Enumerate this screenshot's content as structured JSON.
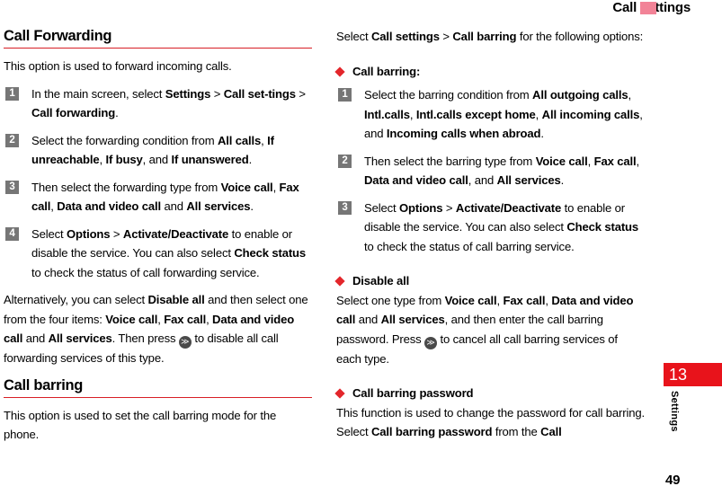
{
  "header": {
    "title": "Call settings",
    "mark_color": "#F28397"
  },
  "chapter_tab": {
    "number": "13",
    "label": "Settings",
    "color": "#E8131B"
  },
  "page_number": "49",
  "theme": {
    "rule_color": "#D81F26",
    "diamond_color": "#E3262B",
    "step_badge_color": "#767676",
    "key_icon_color": "#4A4A4A"
  },
  "icons": {
    "key": "≫",
    "key_name": "end-key-icon"
  },
  "left_column": {
    "heading_1": "Call Forwarding",
    "intro": "This option is used to forward incoming calls.",
    "steps": [
      {
        "num": "1",
        "parts": [
          {
            "t": "In the main screen, select ",
            "b": false
          },
          {
            "t": "Settings",
            "b": true
          },
          {
            "t": " > ",
            "b": false
          },
          {
            "t": "Call set-tings",
            "b": true
          },
          {
            "t": " > ",
            "b": false
          },
          {
            "t": "Call forwarding",
            "b": true
          },
          {
            "t": ".",
            "b": false
          }
        ]
      },
      {
        "num": "2",
        "parts": [
          {
            "t": "Select the forwarding condition from ",
            "b": false
          },
          {
            "t": "All calls",
            "b": true
          },
          {
            "t": ", ",
            "b": false
          },
          {
            "t": "If unreachable",
            "b": true
          },
          {
            "t": ", ",
            "b": false
          },
          {
            "t": "If busy",
            "b": true
          },
          {
            "t": ", and ",
            "b": false
          },
          {
            "t": "If unanswered",
            "b": true
          },
          {
            "t": ".",
            "b": false
          }
        ]
      },
      {
        "num": "3",
        "parts": [
          {
            "t": "Then select the forwarding type from ",
            "b": false
          },
          {
            "t": "Voice call",
            "b": true
          },
          {
            "t": ", ",
            "b": false
          },
          {
            "t": "Fax call",
            "b": true
          },
          {
            "t": ", ",
            "b": false
          },
          {
            "t": "Data and video call",
            "b": true
          },
          {
            "t": " and ",
            "b": false
          },
          {
            "t": "All services",
            "b": true
          },
          {
            "t": ".",
            "b": false
          }
        ]
      },
      {
        "num": "4",
        "parts": [
          {
            "t": "Select ",
            "b": false
          },
          {
            "t": "Options",
            "b": true
          },
          {
            "t": " > ",
            "b": false
          },
          {
            "t": "Activate/Deactivate",
            "b": true
          },
          {
            "t": " to enable or disable the service. You can also select ",
            "b": false
          },
          {
            "t": "Check status",
            "b": true
          },
          {
            "t": " to check the status of call forwarding service.",
            "b": false
          }
        ]
      }
    ],
    "alternatively": {
      "parts": [
        {
          "t": "Alternatively, you can select ",
          "b": false
        },
        {
          "t": "Disable all",
          "b": true
        },
        {
          "t": " and then select one from the four items: ",
          "b": false
        },
        {
          "t": "Voice call",
          "b": true
        },
        {
          "t": ", ",
          "b": false
        },
        {
          "t": "Fax call",
          "b": true
        },
        {
          "t": ", ",
          "b": false
        },
        {
          "t": "Data and video call",
          "b": true
        },
        {
          "t": " and ",
          "b": false
        },
        {
          "t": "All services",
          "b": true
        },
        {
          "t": ". Then press ",
          "b": false
        },
        {
          "t": "[KEY]",
          "b": false
        },
        {
          "t": " to disable all call forwarding services of this type.",
          "b": false
        }
      ]
    },
    "heading_2": "Call barring",
    "barring_intro": "This option is used to set the call barring mode for the phone."
  },
  "right_column": {
    "intro": {
      "parts": [
        {
          "t": "Select ",
          "b": false
        },
        {
          "t": "Call settings",
          "b": true
        },
        {
          "t": " > ",
          "b": false
        },
        {
          "t": "Call barring",
          "b": true
        },
        {
          "t": " for the following options:",
          "b": false
        }
      ]
    },
    "section_1_title": "Call barring:",
    "steps": [
      {
        "num": "1",
        "parts": [
          {
            "t": "Select the barring condition from ",
            "b": false
          },
          {
            "t": "All outgoing calls",
            "b": true
          },
          {
            "t": ", ",
            "b": false
          },
          {
            "t": "Intl.calls",
            "b": true
          },
          {
            "t": ", ",
            "b": false
          },
          {
            "t": "Intl.calls except home",
            "b": true
          },
          {
            "t": ", ",
            "b": false
          },
          {
            "t": "All incoming calls",
            "b": true
          },
          {
            "t": ", and ",
            "b": false
          },
          {
            "t": "Incoming calls when abroad",
            "b": true
          },
          {
            "t": ".",
            "b": false
          }
        ]
      },
      {
        "num": "2",
        "parts": [
          {
            "t": "Then select the barring type from ",
            "b": false
          },
          {
            "t": "Voice call",
            "b": true
          },
          {
            "t": ", ",
            "b": false
          },
          {
            "t": "Fax call",
            "b": true
          },
          {
            "t": ", ",
            "b": false
          },
          {
            "t": "Data and video call",
            "b": true
          },
          {
            "t": ", and ",
            "b": false
          },
          {
            "t": "All services",
            "b": true
          },
          {
            "t": ".",
            "b": false
          }
        ]
      },
      {
        "num": "3",
        "parts": [
          {
            "t": "Select ",
            "b": false
          },
          {
            "t": "Options",
            "b": true
          },
          {
            "t": " > ",
            "b": false
          },
          {
            "t": "Activate/Deactivate",
            "b": true
          },
          {
            "t": " to enable or disable the service. You can also select ",
            "b": false
          },
          {
            "t": "Check status",
            "b": true
          },
          {
            "t": " to check the status of call barring service.",
            "b": false
          }
        ]
      }
    ],
    "section_2_title": "Disable all",
    "section_2_body": {
      "parts": [
        {
          "t": "Select one type from ",
          "b": false
        },
        {
          "t": "Voice call",
          "b": true
        },
        {
          "t": ", ",
          "b": false
        },
        {
          "t": "Fax call",
          "b": true
        },
        {
          "t": ", ",
          "b": false
        },
        {
          "t": "Data and video call",
          "b": true
        },
        {
          "t": " and ",
          "b": false
        },
        {
          "t": "All services",
          "b": true
        },
        {
          "t": ", and then enter the call barring password. Press ",
          "b": false
        },
        {
          "t": "[KEY]",
          "b": false
        },
        {
          "t": " to cancel all call barring services of each type.",
          "b": false
        }
      ]
    },
    "section_3_title": "Call barring password",
    "section_3_body": {
      "parts": [
        {
          "t": "This function is used to change the password for call barring. Select ",
          "b": false
        },
        {
          "t": "Call barring password",
          "b": true
        },
        {
          "t": " from the ",
          "b": false
        },
        {
          "t": "Call",
          "b": true
        }
      ]
    }
  }
}
